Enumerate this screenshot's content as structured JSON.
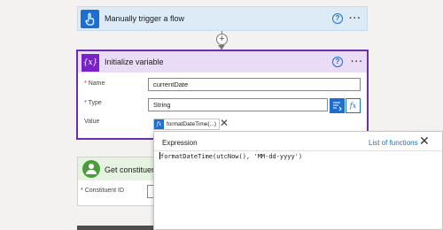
{
  "trigger": {
    "title": "Manually trigger a flow",
    "icon": "hand-touch-icon",
    "help": "?",
    "more": "···"
  },
  "connector": {
    "add": "+"
  },
  "init": {
    "title": "Initialize variable",
    "icon_text": "{x}",
    "help": "?",
    "more": "···",
    "name_label": "Name",
    "name_value": "currentDate",
    "type_label": "Type",
    "type_value": "String",
    "value_label": "Value",
    "required_mark": "*",
    "dynamic_icon": "dynamic-content-icon",
    "fx_label": "fx",
    "token_fx": "fx",
    "token_label": "formatDateTime(...)",
    "token_remove": "✕"
  },
  "get": {
    "title": "Get constituent n",
    "field_label": "Constituent ID",
    "required_mark": "*"
  },
  "expression": {
    "tab": "Expression",
    "link": "List of functions",
    "close": "✕",
    "input": "formatDateTime(utcNow(), 'MM-dd-yyyy')"
  },
  "colors": {
    "accent": "#1c6fd1",
    "variable_border": "#6a2fb0",
    "variable_header": "#eadbf7",
    "trigger_header": "#ddebf7",
    "constituent_header": "#e6f3e0"
  }
}
